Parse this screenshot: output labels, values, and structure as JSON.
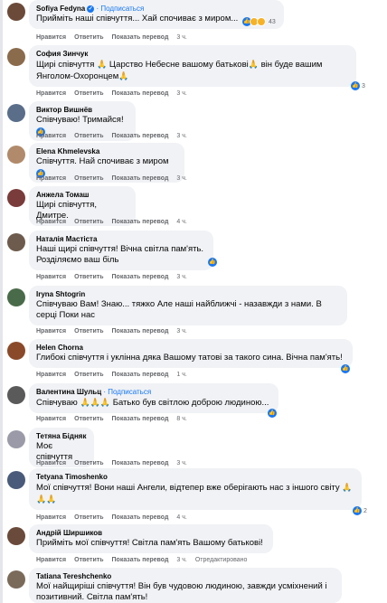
{
  "actions": {
    "like": "Нравится",
    "reply": "Ответить",
    "translate": "Показать перевод"
  },
  "comments": [
    {
      "name": "Sofiya Fedyna",
      "follow": "· Подписаться",
      "text": "Прийміть наші співчуття... Хай спочиває з миром...",
      "time": "3 ч.",
      "reactions": "43",
      "avatar_color": "#6b4a3a"
    },
    {
      "name": "София Зинчук",
      "text_a": "Щирі співчуття",
      "text_b": "Царство Небесне вашому батькові",
      "text_c": "він буде вашим Янголом-Охоронцем",
      "time": "3 ч.",
      "reactions": "3",
      "avatar_color": "#8a6b4c"
    },
    {
      "name": "Виктор Вишнёв",
      "text": "Співчуваю! Тримайся!",
      "time": "3 ч.",
      "avatar_color": "#5a6e8a"
    },
    {
      "name": "Elena Khmelevska",
      "text": "Співчуття. Най спочиває з миром",
      "time": "3 ч.",
      "avatar_color": "#b08a6a"
    },
    {
      "name": "Анжела Томаш",
      "text": "Щирі співчуття, Дмитре.",
      "time": "4 ч.",
      "avatar_color": "#7a3b3b"
    },
    {
      "name": "Наталія Мастіста",
      "text": "Наші щирі співчуття! Вічна світла пам'ять. Розділяємо ваш біль",
      "time": "3 ч.",
      "avatar_color": "#6d5b4d"
    },
    {
      "name": "Iryna Shtogrin",
      "text": "Співчуваю Вам! Знаю... тяжко Але наші найближчі - назавжди з нами. В серці Поки нас",
      "time": "3 ч.",
      "avatar_color": "#4a6b4a"
    },
    {
      "name": "Helen Chorna",
      "text": "Глибокі співчуття і уклінна дяка Вашому татові за такого сина. Вічна пам'ять!",
      "time": "1 ч.",
      "avatar_color": "#8a4a2a"
    },
    {
      "name": "Валентина Шульц",
      "follow": "· Подписаться",
      "text_a": "Співчуваю",
      "text_b": "Батько був світлою доброю людиною...",
      "time": "8 ч.",
      "avatar_color": "#5a5a5a"
    },
    {
      "name": "Тетяна Бідняк",
      "text": "Моє співчуття",
      "time": "3 ч.",
      "avatar_color": "#9a9aa8"
    },
    {
      "name": "Tetyana Timoshenko",
      "text": "Мої співчуття! Вони наші Ангели, відтепер вже оберігають нас з іншого світу",
      "time": "4 ч.",
      "reactions": "2",
      "avatar_color": "#4a5a7a"
    },
    {
      "name": "Андрій Ширшиков",
      "text": "Прийміть мої співчуття! Світла пам'ять Вашому батькові!",
      "time": "3 ч.",
      "edited": "Отредактировано",
      "avatar_color": "#6a4a3a"
    },
    {
      "name": "Tatiana Tereshchenko",
      "text": "Мої найщиріші співчуття! Він був чудовою людиною, завжди усміхнений і позитивний. Світла пам'ять!",
      "avatar_color": "#7a6a5a"
    }
  ]
}
